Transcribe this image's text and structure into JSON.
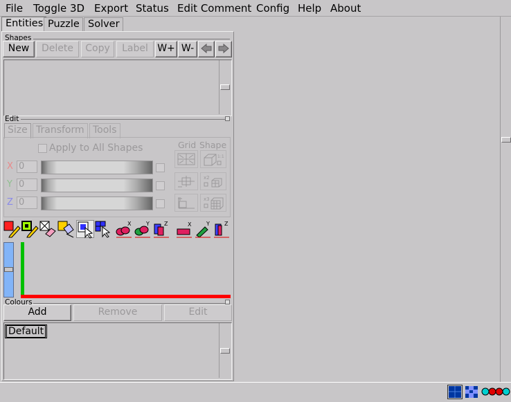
{
  "menu": [
    "File",
    "Toggle 3D",
    "Export",
    "Status",
    "Edit Comment",
    "Config",
    "Help",
    "About"
  ],
  "tabs": [
    "Entities",
    "Puzzle",
    "Solver"
  ],
  "shapes": {
    "label": "Shapes",
    "buttons": {
      "new": "New",
      "delete": "Delete",
      "copy": "Copy",
      "label": "Label",
      "w_plus": "W+",
      "w_minus": "W-"
    }
  },
  "edit": {
    "label": "Edit",
    "subtabs": [
      "Size",
      "Transform",
      "Tools"
    ],
    "apply_all": "Apply to All Shapes",
    "grid_label": "Grid",
    "shape_label": "Shape",
    "axes": [
      {
        "name": "X",
        "value": "0",
        "color": "#e98a8a"
      },
      {
        "name": "Y",
        "value": "0",
        "color": "#8fbf8f"
      },
      {
        "name": "Z",
        "value": "0",
        "color": "#8a8ae9"
      }
    ],
    "shape_tool_badges": [
      "1:1",
      "x2",
      "x3"
    ]
  },
  "colours": {
    "label": "Colours",
    "buttons": {
      "add": "Add",
      "remove": "Remove",
      "edit": "Edit"
    },
    "items": [
      "Default"
    ]
  },
  "colors": {
    "background": "#c8c6c8",
    "red_axis": "#ff0000",
    "green_axis": "#00c000",
    "blue_indicator": "#82b4f8",
    "status_blue": "#0036a0",
    "status_cyan": "#00d0d0",
    "status_red": "#e00000"
  }
}
